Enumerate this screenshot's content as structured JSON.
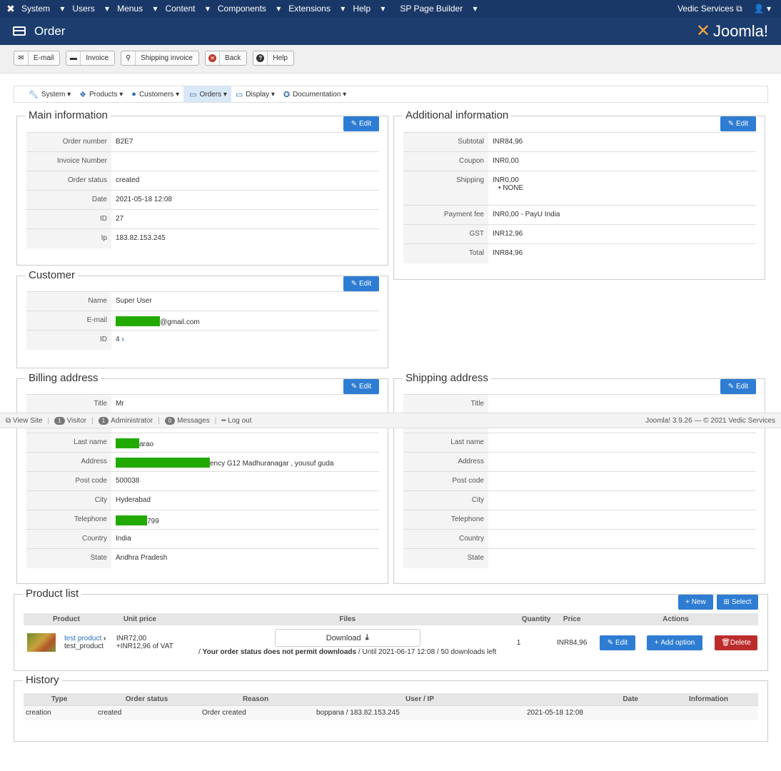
{
  "topbar": {
    "menu": [
      "System",
      "Users",
      "Menus",
      "Content",
      "Components",
      "Extensions",
      "Help",
      "SP Page Builder"
    ],
    "site_name": "Vedic Services"
  },
  "header": {
    "title": "Order",
    "brand": "Joomla!"
  },
  "toolbar": {
    "email": "E-mail",
    "invoice": "Invoice",
    "shipping_invoice": "Shipping invoice",
    "back": "Back",
    "help": "Help"
  },
  "subnav": [
    "System",
    "Products",
    "Customers",
    "Orders",
    "Display",
    "Documentation"
  ],
  "edit_label": "Edit",
  "main_info": {
    "legend": "Main information",
    "rows": [
      {
        "k": "Order number",
        "v": "B2E7"
      },
      {
        "k": "Invoice Number",
        "v": ""
      },
      {
        "k": "Order status",
        "v": "created"
      },
      {
        "k": "Date",
        "v": "2021-05-18 12:08"
      },
      {
        "k": "ID",
        "v": "27"
      },
      {
        "k": "Ip",
        "v": "183.82.153.245"
      }
    ]
  },
  "additional_info": {
    "legend": "Additional information",
    "subtotal_k": "Subtotal",
    "subtotal_v": "INR84,96",
    "coupon_k": "Coupon",
    "coupon_v": "INR0,00",
    "shipping_k": "Shipping",
    "shipping_v": "INR0,00",
    "shipping_method": "NONE",
    "payment_k": "Payment fee",
    "payment_v": "INR0,00 - PayU India",
    "gst_k": "GST",
    "gst_v": "INR12,96",
    "total_k": "Total",
    "total_v": "INR84,96"
  },
  "customer": {
    "legend": "Customer",
    "name_k": "Name",
    "name_v": "Super User",
    "email_k": "E-mail",
    "email_v": "@gmail.com",
    "id_k": "ID",
    "id_v": "4"
  },
  "billing": {
    "legend": "Billing address",
    "title_k": "Title",
    "title_v": "Mr",
    "lastname_k": "Last name",
    "lastname_v": "arao",
    "address_k": "Address",
    "address_v": "ency G12 Madhuranagar , yousuf guda",
    "postcode_k": "Post code",
    "postcode_v": "500038",
    "city_k": "City",
    "city_v": "Hyderabad",
    "telephone_k": "Telephone",
    "telephone_v": "799",
    "country_k": "Country",
    "country_v": "India",
    "state_k": "State",
    "state_v": "Andhra Pradesh"
  },
  "shipping": {
    "legend": "Shipping address",
    "title_k": "Title",
    "lastname_k": "Last name",
    "address_k": "Address",
    "postcode_k": "Post code",
    "city_k": "City",
    "telephone_k": "Telephone",
    "country_k": "Country",
    "state_k": "State"
  },
  "statusbar": {
    "view_site": "View Site",
    "visitor_count": "1",
    "visitor": "Visitor",
    "admin_count": "1",
    "admin": "Administrator",
    "messages_count": "0",
    "messages": "Messages",
    "logout": "Log out",
    "footer": "Joomla! 3.9.26 — © 2021 Vedic Services"
  },
  "product_list": {
    "legend": "Product list",
    "new_label": "New",
    "select_label": "Select",
    "headers": [
      "Product",
      "Unit price",
      "Files",
      "Quantity",
      "Price",
      "Actions"
    ],
    "product_name": "test product",
    "product_code": "test_product",
    "unit_price": "INR72,00",
    "vat": "+INR12,96 of VAT",
    "download_label": "Download",
    "download_status": "Your order status does not permit downloads",
    "download_until": "/ Until 2021-06-17 12:08 / 50 downloads left",
    "quantity": "1",
    "price": "INR84,96",
    "edit_label": "Edit",
    "add_option_label": "Add option",
    "delete_label": "Delete"
  },
  "history": {
    "legend": "History",
    "headers": [
      "Type",
      "Order status",
      "Reason",
      "User / IP",
      "Date",
      "Information"
    ],
    "row": {
      "type": "creation",
      "status": "created",
      "reason": "Order created",
      "user": "boppana / 183.82.153.245",
      "date": "2021-05-18 12:08",
      "info": ""
    }
  }
}
